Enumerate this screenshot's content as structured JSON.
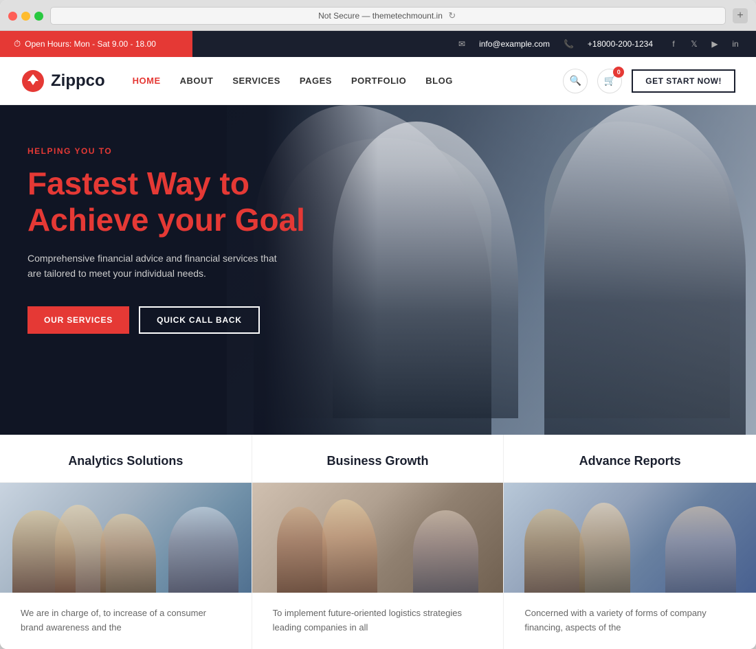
{
  "browser": {
    "address": "Not Secure — themetechmount.in",
    "new_tab_icon": "+"
  },
  "topbar": {
    "left": {
      "open_hours": "Open Hours: Mon - Sat 9.00 - 18.00"
    },
    "right": {
      "email_icon": "✉",
      "email": "info@example.com",
      "phone_icon": "📞",
      "phone": "+18000-200-1234",
      "social": [
        "f",
        "𝕏",
        "▶",
        "in"
      ]
    }
  },
  "header": {
    "logo_text": "Zippco",
    "nav": [
      {
        "label": "HOME",
        "active": true
      },
      {
        "label": "ABOUT",
        "active": false
      },
      {
        "label": "SERVICES",
        "active": false
      },
      {
        "label": "PAGES",
        "active": false
      },
      {
        "label": "PORTFOLIO",
        "active": false
      },
      {
        "label": "BLOG",
        "active": false
      }
    ],
    "cart_count": "0",
    "get_start": "GET START NOW!"
  },
  "hero": {
    "subtitle": "HELPING YOU TO",
    "title_line1": "Fastest Way to",
    "title_line2": "Achieve your ",
    "title_highlight": "Goal",
    "description": "Comprehensive financial advice and financial services that are tailored to meet your individual needs.",
    "btn_primary": "OUR SERVICES",
    "btn_outline": "QUICK CALL BACK"
  },
  "services": [
    {
      "title": "Analytics Solutions",
      "description": "We are in charge of, to increase of a consumer brand awareness and the"
    },
    {
      "title": "Business Growth",
      "description": "To implement future-oriented logistics strategies leading companies in all"
    },
    {
      "title": "Advance Reports",
      "description": "Concerned with a variety of forms of company financing, aspects of the"
    }
  ]
}
